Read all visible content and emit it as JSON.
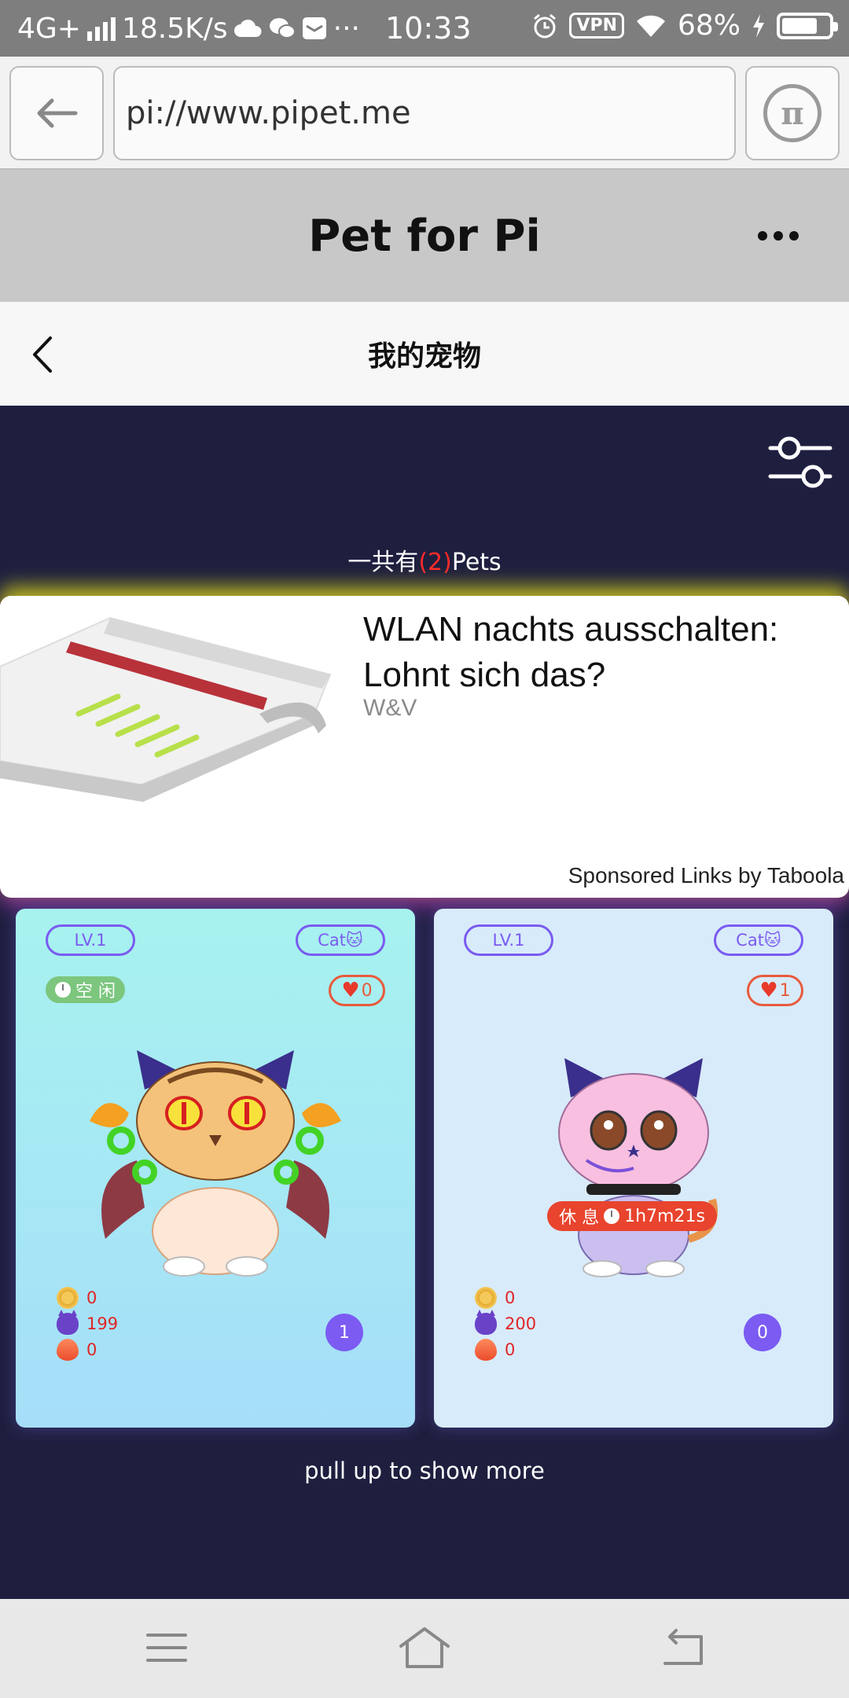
{
  "status_bar": {
    "network": "4G+",
    "speed": "18.5K/s",
    "time": "10:33",
    "vpn": "VPN",
    "battery_percent": "68%",
    "battery_level": 0.68
  },
  "browser": {
    "url": "pi://www.pipet.me",
    "pi_symbol": "π"
  },
  "app": {
    "title": "Pet for Pi"
  },
  "page": {
    "title": "我的宠物",
    "count_prefix": "一共有",
    "count_value": "(2)",
    "count_suffix": "Pets"
  },
  "ad": {
    "headline": "WLAN nachts ausschalten: Lohnt sich das?",
    "source": "W&V",
    "sponsored": "Sponsored Links by Taboola"
  },
  "pets": [
    {
      "level": "LV.1",
      "type": "Cat🐱",
      "status": "空 闲",
      "likes": "0",
      "coins": "0",
      "devil": "199",
      "fire": "0",
      "badge_number": "1"
    },
    {
      "level": "LV.1",
      "type": "Cat🐱",
      "likes": "1",
      "rest_label": "休 息",
      "rest_time": "1h7m21s",
      "coins": "0",
      "devil": "200",
      "fire": "0",
      "badge_number": "0"
    }
  ],
  "footer": {
    "pull_more": "pull up to show more"
  },
  "icons": {
    "back": "arrow-left-icon",
    "pi": "pi-logo-icon",
    "more": "more-horizontal-icon",
    "chevron": "chevron-left-icon",
    "filter": "sliders-icon",
    "menu": "menu-icon",
    "home": "home-icon",
    "return": "return-icon"
  },
  "colors": {
    "dark_background": "#1e1f3f",
    "accent_purple": "#7b5bf2",
    "count_red": "#ff2a2a",
    "rest_red": "#e8442e",
    "idle_green": "#7cc67e"
  }
}
